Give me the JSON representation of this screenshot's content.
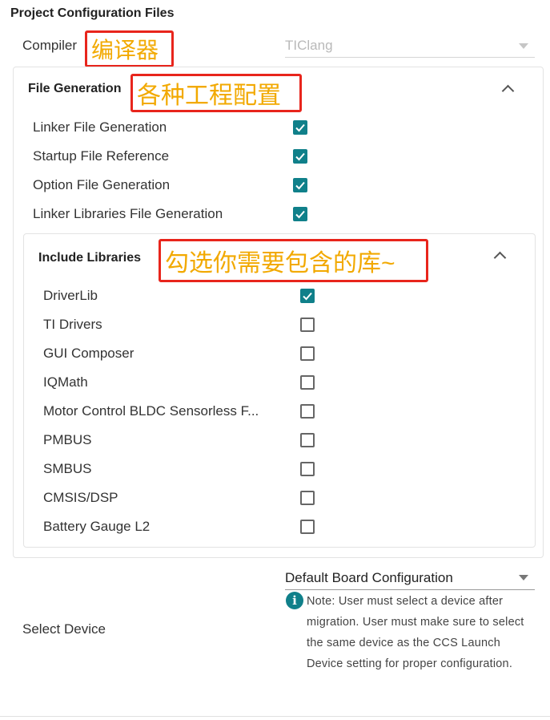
{
  "section_title": "Project Configuration Files",
  "compiler": {
    "label": "Compiler",
    "value": "TIClang",
    "annotation": "编译器"
  },
  "file_generation": {
    "title": "File Generation",
    "annotation": "各种工程配置",
    "items": [
      {
        "label": "Linker File Generation",
        "checked": true
      },
      {
        "label": "Startup File Reference",
        "checked": true
      },
      {
        "label": "Option File Generation",
        "checked": true
      },
      {
        "label": "Linker Libraries File Generation",
        "checked": true
      }
    ]
  },
  "include_libraries": {
    "title": "Include Libraries",
    "annotation": "勾选你需要包含的库~",
    "items": [
      {
        "label": "DriverLib",
        "checked": true
      },
      {
        "label": "TI Drivers",
        "checked": false
      },
      {
        "label": "GUI Composer",
        "checked": false
      },
      {
        "label": "IQMath",
        "checked": false
      },
      {
        "label": "Motor Control BLDC Sensorless F...",
        "checked": false
      },
      {
        "label": "PMBUS",
        "checked": false
      },
      {
        "label": "SMBUS",
        "checked": false
      },
      {
        "label": "CMSIS/DSP",
        "checked": false
      },
      {
        "label": "Battery Gauge L2",
        "checked": false
      }
    ]
  },
  "device": {
    "label": "Select Device",
    "select_value": "Default Board Configuration",
    "note": "Note: User must select a device after migration. User must make sure to select the same device as the CCS Launch Device setting for proper configuration."
  },
  "colors": {
    "accent": "#10808a",
    "annotation_border": "#e8251c",
    "annotation_text": "#f2a900"
  },
  "icons": {
    "collapse": "chevron-up-icon",
    "dropdown": "caret-down-icon",
    "info": "info-icon",
    "check": "check-icon"
  }
}
